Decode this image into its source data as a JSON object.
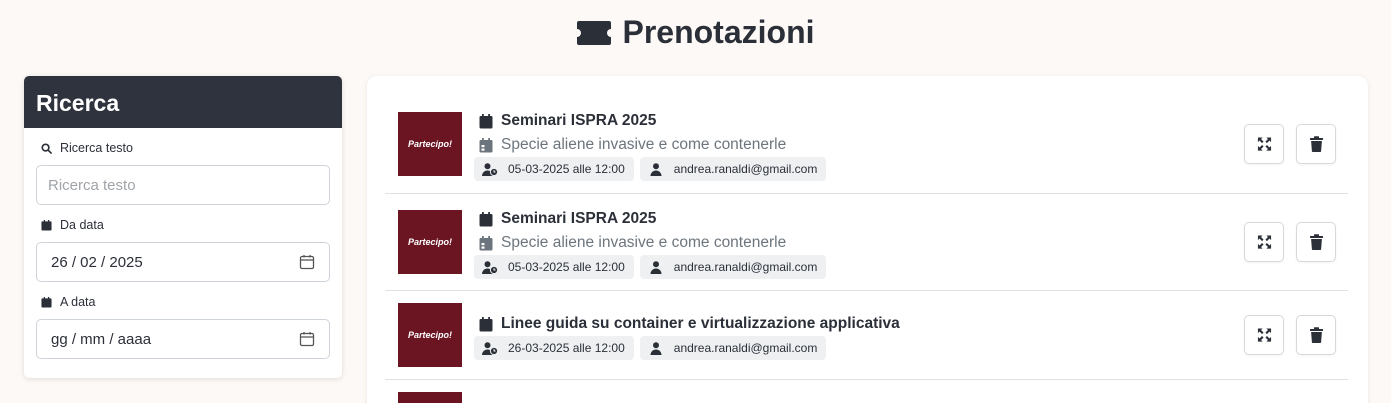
{
  "header": {
    "title": "Prenotazioni",
    "icon": "ticket-icon"
  },
  "sidebar": {
    "title": "Ricerca",
    "search": {
      "label": "Ricerca testo",
      "placeholder": "Ricerca testo",
      "value": ""
    },
    "from_date": {
      "label": "Da data",
      "value": "26 / 02 / 2025"
    },
    "to_date": {
      "label": "A data",
      "value": "gg / mm / aaaa"
    }
  },
  "bookings": [
    {
      "logo_text": "Partecipo!",
      "title": "Seminari ISPRA 2025",
      "subtitle": "Specie aliene invasive e come contenerle",
      "datetime": "05-03-2025 alle 12:00",
      "email": "andrea.ranaldi@gmail.com"
    },
    {
      "logo_text": "Partecipo!",
      "title": "Seminari ISPRA 2025",
      "subtitle": "Specie aliene invasive e come contenerle",
      "datetime": "05-03-2025 alle 12:00",
      "email": "andrea.ranaldi@gmail.com"
    },
    {
      "logo_text": "Partecipo!",
      "title": "Linee guida su container e virtualizzazione applicativa",
      "subtitle": "",
      "datetime": "26-03-2025 alle 12:00",
      "email": "andrea.ranaldi@gmail.com"
    }
  ],
  "colors": {
    "accent_dark": "#2f333d",
    "logo_bg": "#6b1523",
    "page_bg": "#fdf9f6"
  }
}
